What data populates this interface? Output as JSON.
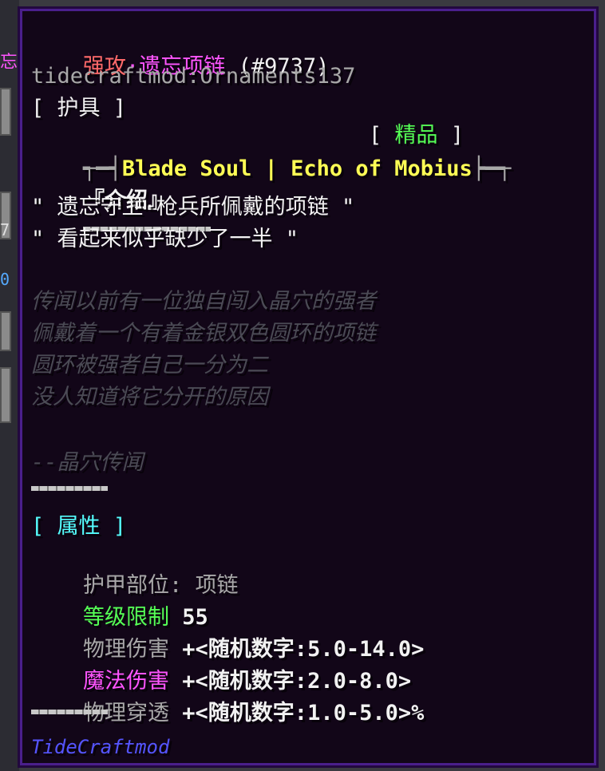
{
  "side": {
    "label_a": "忘",
    "label_b": "7",
    "label_c": "0"
  },
  "tooltip": {
    "title_prefix": "强攻",
    "title_dot": "·",
    "title_name": "遗忘项链",
    "title_id": "(#9737)",
    "registry": "tidecraftmod:Ornaments137",
    "category": "[ 护具 ]",
    "rarity_open": "[ ",
    "rarity": "精品",
    "rarity_close": " ]",
    "set_left": "┭━┥",
    "set_name_a": "Blade Soul",
    "set_sep": " | ",
    "set_name_b": "Echo of Mobius",
    "set_right": "┝━┭",
    "intro_header": "『介绍』",
    "quote_1": "\" 遗忘守卫·枪兵所佩戴的项链 \"",
    "quote_2": "\" 看起来似乎缺少了一半 \"",
    "lore": [
      "传闻以前有一位独自闯入晶穴的强者",
      "佩戴着一个有着金银双色圆环的项链",
      "圆环被强者自己一分为二",
      "没人知道将它分开的原因"
    ],
    "lore_source": "--晶穴传闻",
    "attr_header": "[ 属性 ]",
    "slot_label": "护甲部位:",
    "slot_value": "项链",
    "level_label": "等级限制",
    "level_value": "55",
    "phys_label": "物理伤害",
    "phys_value": "+<随机数字:5.0-14.0>",
    "magic_label": "魔法伤害",
    "magic_value": "+<随机数字:2.0-8.0>",
    "pen_label": "物理穿透",
    "pen_value": "+<随机数字:1.0-5.0>%",
    "mod_name": "TideCraftmod"
  },
  "colors": {
    "background": "#120618",
    "border": "#4a1f8c",
    "green": "#55ff55",
    "yellow": "#ffff55",
    "aqua": "#55ffff",
    "magenta": "#ff55ff",
    "blue": "#5555ff"
  }
}
